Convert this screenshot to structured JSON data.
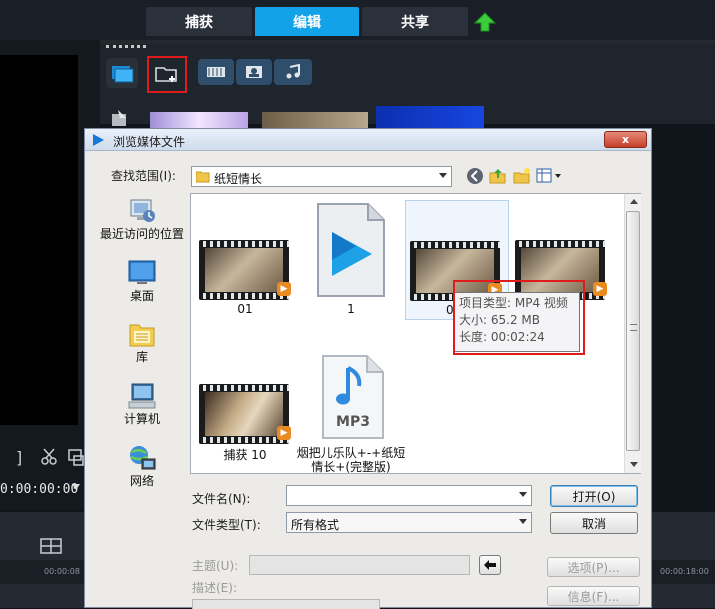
{
  "app": {
    "tabs": [
      {
        "label": "捕获",
        "active": false
      },
      {
        "label": "编辑",
        "active": true
      },
      {
        "label": "共享",
        "active": false
      }
    ],
    "upload_icon": "up-arrow-icon",
    "timecode": "0:00:00:00",
    "ruler_ticks": [
      "00:00:08",
      "00:00:18:00"
    ]
  },
  "dialog": {
    "title": "浏览媒体文件",
    "close_label": "x",
    "lookin_label": "查找范围(I):",
    "lookin_value": "纸短情长",
    "places": [
      {
        "label": "最近访问的位置",
        "icon": "recent-places-icon"
      },
      {
        "label": "桌面",
        "icon": "desktop-icon"
      },
      {
        "label": "库",
        "icon": "libraries-icon"
      },
      {
        "label": "计算机",
        "icon": "computer-icon"
      },
      {
        "label": "网络",
        "icon": "network-icon"
      }
    ],
    "files": [
      {
        "name": "01",
        "type": "video"
      },
      {
        "name": "1",
        "type": "app"
      },
      {
        "name": "0",
        "type": "video"
      },
      {
        "name": "",
        "type": "video"
      },
      {
        "name": "捕获 10",
        "type": "video"
      },
      {
        "name": "烟把儿乐队+-+纸短情长+(完整版)",
        "type": "mp3"
      }
    ],
    "mp3_badge": "MP3",
    "tooltip": {
      "type_line": "项目类型: MP4 视频",
      "size_line": "大小: 65.2 MB",
      "length_line": "长度: 00:02:24"
    },
    "filename_label": "文件名(N):",
    "filename_value": "",
    "filetype_label": "文件类型(T):",
    "filetype_value": "所有格式",
    "open_label": "打开(O)",
    "cancel_label": "取消",
    "subject_label": "主题(U):",
    "desc_label": "描述(E):",
    "options_label": "选项(P)...",
    "info_label": "信息(F)..."
  },
  "colors": {
    "active_tab": "#12a2e8",
    "highlight_red": "#e01b1b"
  }
}
